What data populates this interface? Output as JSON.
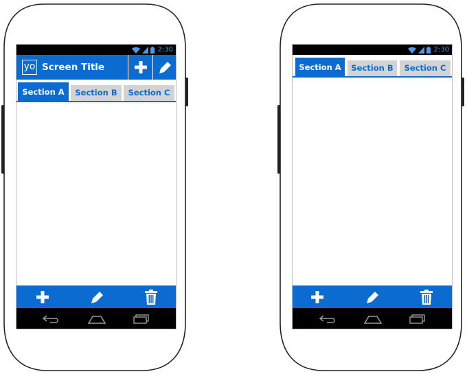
{
  "colors": {
    "accent": "#0b6bd0",
    "tab_inactive_bg": "#d3d3d3",
    "statusbar_bg": "#000000",
    "navbar_bg": "#000000",
    "status_text": "#4a9be8"
  },
  "left_phone": {
    "status": {
      "time": "2:30",
      "icons": [
        "wifi-icon",
        "signal-icon",
        "battery-icon"
      ]
    },
    "actionbar": {
      "app_icon_text": "yo",
      "title": "Screen Title",
      "actions": [
        "add-icon",
        "edit-icon"
      ]
    },
    "tabs": [
      {
        "label": "Section A",
        "active": true
      },
      {
        "label": "Section B",
        "active": false
      },
      {
        "label": "Section C",
        "active": false
      }
    ],
    "bottom_actions": [
      "add-icon",
      "edit-icon",
      "trash-icon"
    ],
    "nav": [
      "back-icon",
      "home-icon",
      "recents-icon"
    ]
  },
  "right_phone": {
    "status": {
      "time": "2:30",
      "icons": [
        "wifi-icon",
        "signal-icon",
        "battery-icon"
      ]
    },
    "tabs": [
      {
        "label": "Section A",
        "active": true
      },
      {
        "label": "Section B",
        "active": false
      },
      {
        "label": "Section C",
        "active": false
      }
    ],
    "bottom_actions": [
      "add-icon",
      "edit-icon",
      "trash-icon"
    ],
    "nav": [
      "back-icon",
      "home-icon",
      "recents-icon"
    ]
  }
}
